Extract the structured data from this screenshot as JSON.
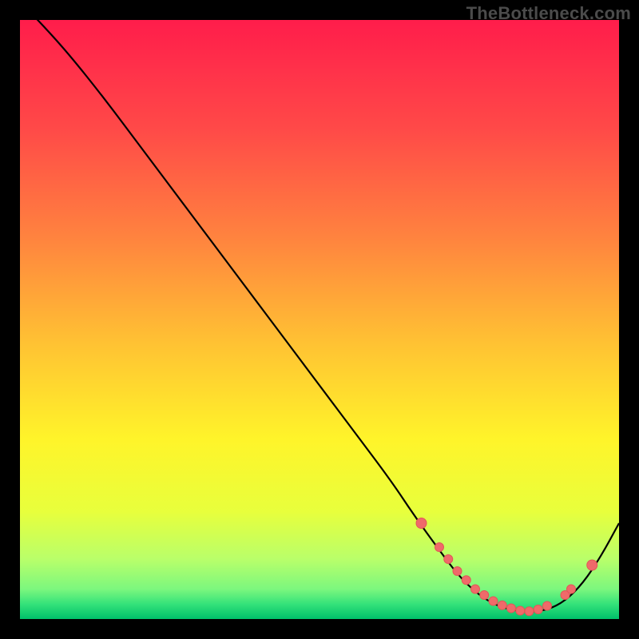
{
  "attribution": "TheBottleneck.com",
  "colors": {
    "frame": "#000000",
    "curve": "#000000",
    "marker_fill": "#ef6a6a",
    "marker_stroke": "#e35757",
    "gradient_stops": [
      {
        "offset": 0.0,
        "color": "#ff1d4b"
      },
      {
        "offset": 0.18,
        "color": "#ff4948"
      },
      {
        "offset": 0.36,
        "color": "#ff823f"
      },
      {
        "offset": 0.54,
        "color": "#ffc233"
      },
      {
        "offset": 0.7,
        "color": "#fff42a"
      },
      {
        "offset": 0.82,
        "color": "#e8ff3c"
      },
      {
        "offset": 0.9,
        "color": "#b9ff6a"
      },
      {
        "offset": 0.95,
        "color": "#7cf77e"
      },
      {
        "offset": 0.975,
        "color": "#34e27a"
      },
      {
        "offset": 1.0,
        "color": "#00c06a"
      }
    ]
  },
  "chart_data": {
    "type": "line",
    "title": "",
    "xlabel": "",
    "ylabel": "",
    "xlim": [
      0,
      100
    ],
    "ylim": [
      0,
      100
    ],
    "series": [
      {
        "name": "bottleneck-curve",
        "x": [
          0,
          3,
          8,
          14,
          20,
          26,
          32,
          38,
          44,
          50,
          56,
          62,
          66,
          70,
          73,
          76,
          79,
          82,
          85,
          88,
          91,
          94,
          97,
          100
        ],
        "y": [
          103,
          100,
          94.5,
          87,
          79,
          71,
          63,
          55,
          47,
          39,
          31,
          23,
          17,
          11.5,
          7.5,
          4.5,
          2.5,
          1.5,
          1.2,
          1.5,
          3,
          6,
          10.5,
          16
        ]
      }
    ],
    "markers": {
      "name": "highlighted-points",
      "points": [
        {
          "x": 67,
          "y": 16
        },
        {
          "x": 70,
          "y": 12
        },
        {
          "x": 71.5,
          "y": 10
        },
        {
          "x": 73,
          "y": 8
        },
        {
          "x": 74.5,
          "y": 6.5
        },
        {
          "x": 76,
          "y": 5
        },
        {
          "x": 77.5,
          "y": 4
        },
        {
          "x": 79,
          "y": 3
        },
        {
          "x": 80.5,
          "y": 2.3
        },
        {
          "x": 82,
          "y": 1.8
        },
        {
          "x": 83.5,
          "y": 1.4
        },
        {
          "x": 85,
          "y": 1.3
        },
        {
          "x": 86.5,
          "y": 1.6
        },
        {
          "x": 88,
          "y": 2.2
        },
        {
          "x": 91,
          "y": 4
        },
        {
          "x": 92,
          "y": 5
        },
        {
          "x": 95.5,
          "y": 9
        }
      ],
      "radius_main": 5.5,
      "radius_end": 6.5
    }
  }
}
